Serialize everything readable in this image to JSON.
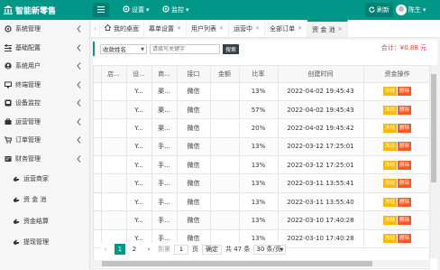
{
  "header": {
    "brand": "智能新零售",
    "settings_label": "设置",
    "monitor_label": "监控",
    "refresh_label": "刷新",
    "username": "陈生"
  },
  "sidebar": {
    "items": [
      {
        "label": "系统管理",
        "icon": "gear-icon"
      },
      {
        "label": "基础配置",
        "icon": "sliders-icon"
      },
      {
        "label": "系统用户",
        "icon": "user-icon"
      },
      {
        "label": "终端管理",
        "icon": "monitor-icon"
      },
      {
        "label": "设备监控",
        "icon": "device-icon"
      },
      {
        "label": "运营管理",
        "icon": "briefcase-icon"
      },
      {
        "label": "订单管理",
        "icon": "cart-icon"
      },
      {
        "label": "财务管理",
        "icon": "finance-icon"
      }
    ],
    "sub_items": [
      {
        "label": "运营商家",
        "icon": "hand-icon"
      },
      {
        "label": "资 金 池",
        "icon": "hand-icon"
      },
      {
        "label": "资金结算",
        "icon": "hand-icon"
      },
      {
        "label": "提现管理",
        "icon": "hand-icon"
      }
    ]
  },
  "tabs": [
    {
      "label": "我的桌面",
      "icon": "home-icon",
      "closable": false
    },
    {
      "label": "幕单设置",
      "closable": true
    },
    {
      "label": "用户列表",
      "closable": true
    },
    {
      "label": "运营中",
      "closable": true
    },
    {
      "label": "全部订单",
      "closable": true
    },
    {
      "label": "资 金 池",
      "closable": true,
      "active": true
    }
  ],
  "toolbar": {
    "select_value": "收款姓名",
    "search_placeholder": "请填写关键字",
    "search_label": "搜索",
    "total_label": "合计：",
    "total_value": "¥0.88 元"
  },
  "table": {
    "columns": [
      "",
      "店...",
      "设...",
      "商...",
      "接口",
      "金额",
      "比率",
      "创建时间",
      "资金操作"
    ],
    "rows": [
      {
        "c0": "",
        "c1": "",
        "c2": "Y...",
        "c3": "渠...",
        "iface": "微信",
        "amount": "",
        "ratio": "13%",
        "time": "2022-04-02 19:45:43"
      },
      {
        "c0": "",
        "c1": "",
        "c2": "Y...",
        "c3": "渠...",
        "iface": "微信",
        "amount": "",
        "ratio": "57%",
        "time": "2022-04-02 19:45:43"
      },
      {
        "c0": "",
        "c1": "",
        "c2": "Y...",
        "c3": "渠...",
        "iface": "微信",
        "amount": "",
        "ratio": "20%",
        "time": "2022-04-02 19:45:42"
      },
      {
        "c0": "",
        "c1": "",
        "c2": "Y...",
        "c3": "手...",
        "iface": "微信",
        "amount": "",
        "ratio": "13%",
        "time": "2022-03-12 17:25:01"
      },
      {
        "c0": "",
        "c1": "",
        "c2": "Y...",
        "c3": "手...",
        "iface": "微信",
        "amount": "",
        "ratio": "13%",
        "time": "2022-03-12 17:25:01"
      },
      {
        "c0": "",
        "c1": "",
        "c2": "Y...",
        "c3": "手...",
        "iface": "微信",
        "amount": "",
        "ratio": "13%",
        "time": "2022-03-11 13:55:41"
      },
      {
        "c0": "",
        "c1": "",
        "c2": "Y...",
        "c3": "手...",
        "iface": "微信",
        "amount": "",
        "ratio": "13%",
        "time": "2022-03-11 13:55:40"
      },
      {
        "c0": "",
        "c1": "",
        "c2": "Y...",
        "c3": "手...",
        "iface": "微信",
        "amount": "",
        "ratio": "13%",
        "time": "2022-03-10 17:40:28"
      },
      {
        "c0": "",
        "c1": "",
        "c2": "Y...",
        "c3": "手...",
        "iface": "微信",
        "amount": "",
        "ratio": "13%",
        "time": "2022-03-10 17:40:28"
      }
    ],
    "op_freeze": "冻结",
    "op_delete": "删除"
  },
  "pagination": {
    "prev": "‹",
    "pages": [
      "1",
      "2"
    ],
    "next": "›",
    "goto_label": "到第",
    "page_input": "1",
    "page_unit": "页",
    "confirm": "确定",
    "total": "共 47 条",
    "page_size": "30 条/页"
  },
  "colors": {
    "primary": "#009688",
    "warn": "#ffb800",
    "danger": "#ff5722",
    "total_red": "#e4393c"
  }
}
